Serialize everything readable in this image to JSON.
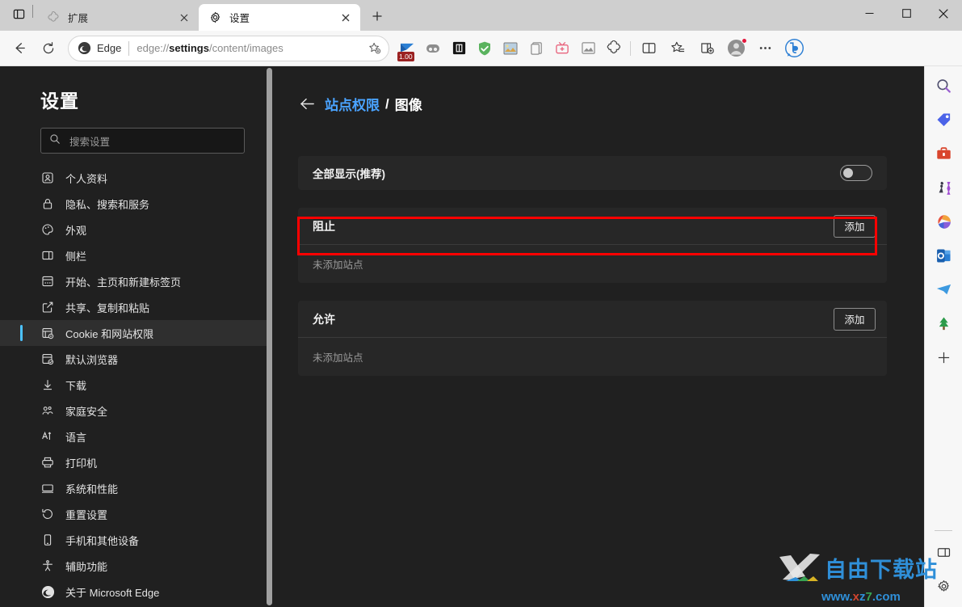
{
  "window": {
    "controls": {
      "minimize": "minimize-icon",
      "maximize": "maximize-icon",
      "close": "close-icon"
    }
  },
  "tabbar": {
    "tab_search_icon": "tab-search-icon",
    "new_tab_icon": "plus-icon",
    "tabs": [
      {
        "title": "扩展",
        "favicon": "puzzle-icon",
        "active": false,
        "close_label": "×"
      },
      {
        "title": "设置",
        "favicon": "gear-icon",
        "active": true,
        "close_label": "×"
      }
    ]
  },
  "toolbar": {
    "back_icon": "back-arrow-icon",
    "refresh_icon": "refresh-icon",
    "omnibox": {
      "edge_label": "Edge",
      "url_prefix": "edge://",
      "url_bold": "settings",
      "url_suffix": "/content/images",
      "url_full": "edge://settings/content/images",
      "favorite_icon": "add-favorite-star-icon"
    },
    "extensions": [
      {
        "name": "zoom-ratio-ext",
        "badge": "1.00"
      },
      {
        "name": "panda-ext",
        "badge": ""
      },
      {
        "name": "li-ext",
        "badge": ""
      },
      {
        "name": "adblock-shield-ext",
        "badge": ""
      },
      {
        "name": "image-ext",
        "badge": ""
      },
      {
        "name": "clipboard-ext",
        "badge": ""
      },
      {
        "name": "tv-ext",
        "badge": ""
      },
      {
        "name": "photo-ext",
        "badge": ""
      },
      {
        "name": "extensions-puzzle-icon",
        "badge": ""
      }
    ],
    "split_screen_icon": "split-screen-icon",
    "favorites_icon": "favorites-icon",
    "collections_icon": "collections-icon",
    "profile_icon": "avatar-icon",
    "more_icon": "ellipsis-icon",
    "copilot_icon": "bing-copilot-icon"
  },
  "settings": {
    "title": "设置",
    "search": {
      "placeholder": "搜索设置",
      "value": "",
      "icon": "search-icon"
    },
    "nav_items": [
      {
        "label": "个人资料",
        "icon": "person-badge-icon",
        "selected": false
      },
      {
        "label": "隐私、搜索和服务",
        "icon": "lock-icon",
        "selected": false
      },
      {
        "label": "外观",
        "icon": "palette-icon",
        "selected": false
      },
      {
        "label": "侧栏",
        "icon": "sidebar-icon",
        "selected": false
      },
      {
        "label": "开始、主页和新建标签页",
        "icon": "home-page-icon",
        "selected": false
      },
      {
        "label": "共享、复制和粘贴",
        "icon": "share-icon",
        "selected": false
      },
      {
        "label": "Cookie 和网站权限",
        "icon": "cookie-permissions-icon",
        "selected": true
      },
      {
        "label": "默认浏览器",
        "icon": "default-browser-icon",
        "selected": false
      },
      {
        "label": "下载",
        "icon": "download-icon",
        "selected": false
      },
      {
        "label": "家庭安全",
        "icon": "family-icon",
        "selected": false
      },
      {
        "label": "语言",
        "icon": "language-icon",
        "selected": false
      },
      {
        "label": "打印机",
        "icon": "printer-icon",
        "selected": false
      },
      {
        "label": "系统和性能",
        "icon": "system-icon",
        "selected": false
      },
      {
        "label": "重置设置",
        "icon": "reset-icon",
        "selected": false
      },
      {
        "label": "手机和其他设备",
        "icon": "phone-icon",
        "selected": false
      },
      {
        "label": "辅助功能",
        "icon": "accessibility-icon",
        "selected": false
      },
      {
        "label": "关于 Microsoft Edge",
        "icon": "edge-logo-icon",
        "selected": false
      }
    ]
  },
  "main": {
    "breadcrumb": {
      "back_icon": "back-arrow-icon",
      "parent": "站点权限",
      "separator": "/",
      "current": "图像"
    },
    "toggle_row": {
      "label": "全部显示(推荐)",
      "state": "off",
      "highlighted": true,
      "highlight_color": "#ff0000"
    },
    "sections": [
      {
        "title": "阻止",
        "add_label": "添加",
        "empty_text": "未添加站点"
      },
      {
        "title": "允许",
        "add_label": "添加",
        "empty_text": "未添加站点"
      }
    ]
  },
  "edgebar": {
    "items": [
      {
        "name": "search-icon"
      },
      {
        "name": "shopping-tag-icon"
      },
      {
        "name": "tools-briefcase-icon"
      },
      {
        "name": "games-icon"
      },
      {
        "name": "microsoft-365-icon"
      },
      {
        "name": "outlook-icon"
      },
      {
        "name": "telegram-paperplane-icon"
      },
      {
        "name": "tree-icon"
      },
      {
        "name": "add-sidebar-app-icon"
      }
    ],
    "bottom": [
      {
        "name": "sidebar-toggle-icon"
      },
      {
        "name": "sidebar-settings-gear-icon"
      }
    ]
  },
  "watermark": {
    "brand_cn": "自由下载站",
    "url": "www.xz7.com",
    "logo": "x-logo-icon"
  },
  "colors": {
    "accent_blue": "#4cc2ff",
    "link_blue": "#4aa3ff",
    "highlight_red": "#ff0000",
    "page_bg": "#202020",
    "card_bg": "#272727",
    "chrome_bg": "#f7f7f7",
    "titlebar_bg": "#cfcfcf"
  }
}
